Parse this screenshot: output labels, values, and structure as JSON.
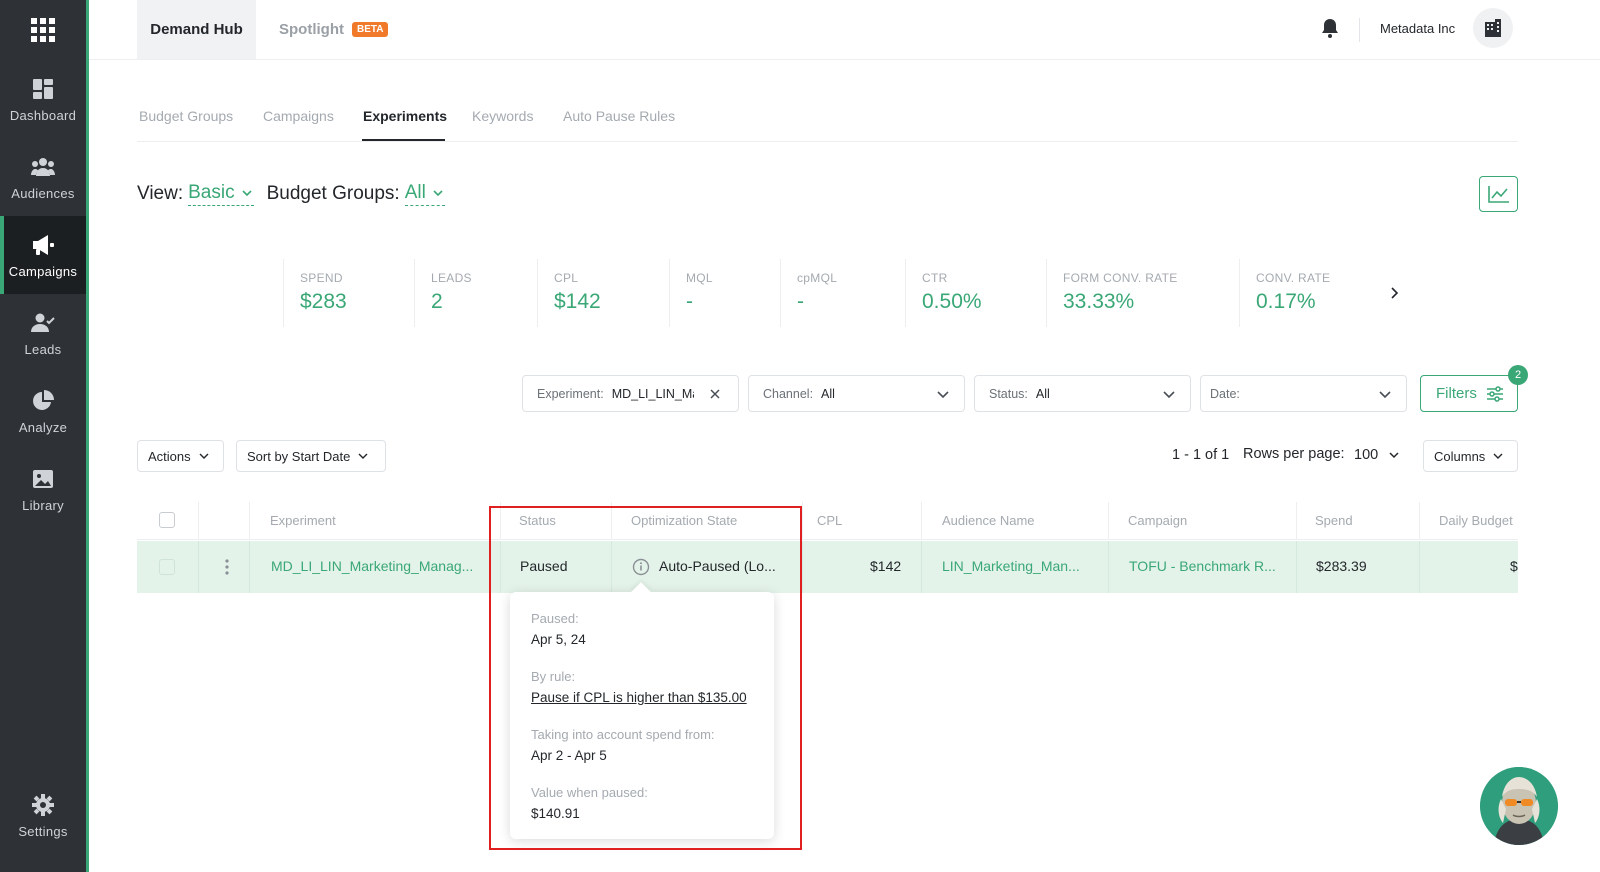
{
  "sidebar": {
    "items": [
      {
        "label": "Dashboard",
        "icon": "dashboard-icon"
      },
      {
        "label": "Audiences",
        "icon": "audiences-icon"
      },
      {
        "label": "Campaigns",
        "icon": "megaphone-icon"
      },
      {
        "label": "Leads",
        "icon": "leads-icon"
      },
      {
        "label": "Analyze",
        "icon": "pie-chart-icon"
      },
      {
        "label": "Library",
        "icon": "image-icon"
      }
    ],
    "settings_label": "Settings",
    "active": "Campaigns"
  },
  "topbar": {
    "tabs": [
      {
        "label": "Demand Hub"
      },
      {
        "label": "Spotlight"
      }
    ],
    "beta_badge": "BETA",
    "org_name": "Metadata Inc"
  },
  "subtabs": [
    "Budget Groups",
    "Campaigns",
    "Experiments",
    "Keywords",
    "Auto Pause Rules"
  ],
  "active_subtab": "Experiments",
  "view": {
    "view_label": "View:",
    "view_value": "Basic",
    "budget_label": "Budget Groups:",
    "budget_value": "All"
  },
  "kpis": [
    {
      "label": "SPEND",
      "value": "$283"
    },
    {
      "label": "LEADS",
      "value": "2"
    },
    {
      "label": "CPL",
      "value": "$142"
    },
    {
      "label": "MQL",
      "value": "-"
    },
    {
      "label": "cpMQL",
      "value": "-"
    },
    {
      "label": "CTR",
      "value": "0.50%"
    },
    {
      "label": "FORM CONV. RATE",
      "value": "33.33%"
    },
    {
      "label": "CONV. RATE",
      "value": "0.17%"
    }
  ],
  "filters": {
    "experiment": {
      "label": "Experiment:",
      "value": "MD_LI_LIN_Ma"
    },
    "channel": {
      "label": "Channel:",
      "value": "All"
    },
    "status": {
      "label": "Status:",
      "value": "All"
    },
    "date": {
      "label": "Date:",
      "value": ""
    },
    "filters_label": "Filters",
    "filters_count": "2"
  },
  "toolbar": {
    "actions_label": "Actions",
    "sort_label": "Sort by Start Date",
    "pager_text": "1 - 1 of 1",
    "rows_per_page_label": "Rows per page:",
    "rows_per_page_value": "100",
    "columns_label": "Columns"
  },
  "table": {
    "headers": [
      "Experiment",
      "Status",
      "Optimization State",
      "CPL",
      "Audience Name",
      "Campaign",
      "Spend",
      "Daily Budget"
    ],
    "row": {
      "experiment": "MD_LI_LIN_Marketing_Manag...",
      "status": "Paused",
      "optimization_state": "Auto-Paused (Lo...",
      "cpl": "$142",
      "audience": "LIN_Marketing_Man...",
      "campaign": "TOFU - Benchmark R...",
      "spend": "$283.39",
      "daily_budget": "$"
    }
  },
  "tooltip": {
    "paused_label": "Paused:",
    "paused_value": "Apr 5, 24",
    "rule_label": "By rule:",
    "rule_value": "Pause if CPL is higher than $135.00",
    "spend_label": "Taking into account spend from:",
    "spend_value": "Apr 2 - Apr 5",
    "value_label": "Value when paused:",
    "value_value": "$140.91"
  },
  "colors": {
    "accent": "#3aa776",
    "sidebar_bg": "#2e3237",
    "row_highlight": "#e4f3ea",
    "beta": "#f07a2a",
    "annotation": "#e02020"
  }
}
